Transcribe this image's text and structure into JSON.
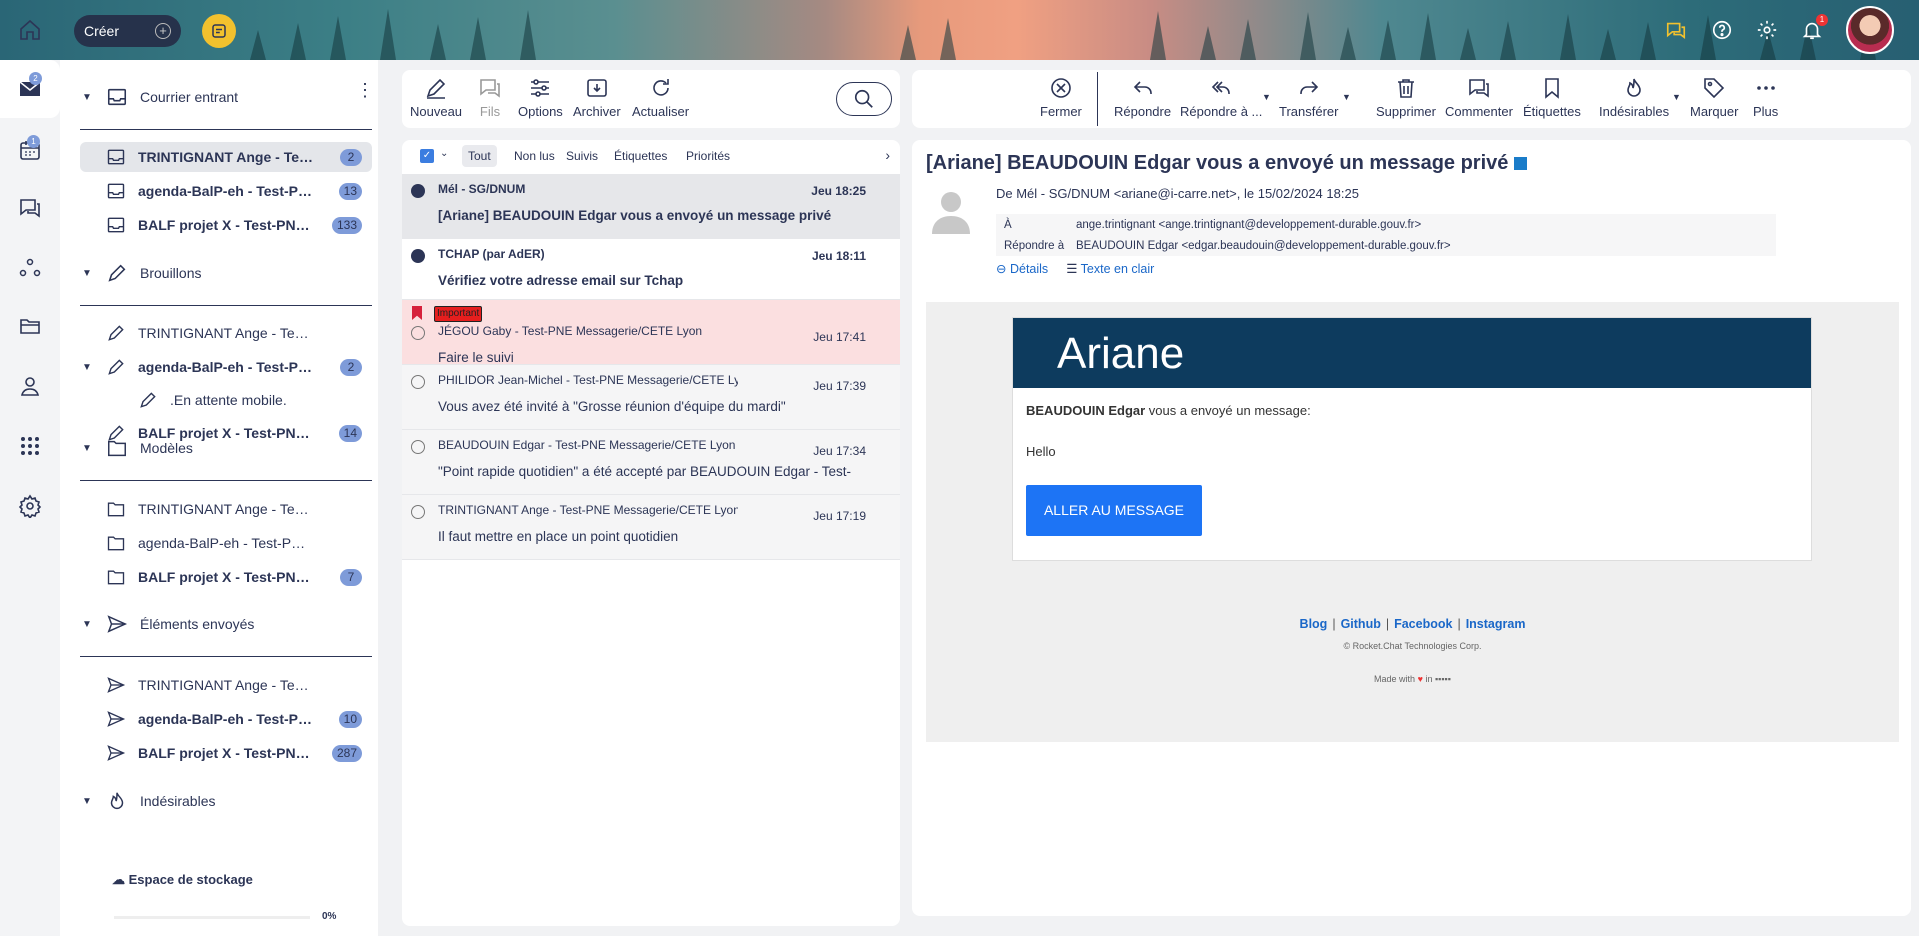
{
  "topbar": {
    "create_label": "Créer",
    "create_plus": "+",
    "notifications_count": "1"
  },
  "leftnav": {
    "mail_badge": "2",
    "calendar_badge": "1"
  },
  "sidebar": {
    "groups": [
      {
        "label": "Courrier entrant",
        "icon": "inbox-icon",
        "items": [
          {
            "label": "TRINTIGNANT Ange - Test-PNE Messagerie/CETE Lyon",
            "badge": "2",
            "bold": true
          },
          {
            "label": "agenda-BalP-eh - Test-PNE Messagerie/CETE Lyon",
            "badge": "13",
            "bold": true
          },
          {
            "label": "BALF projet X - Test-PNE Messagerie/CETE Lyon",
            "badge": "133",
            "bold": true
          }
        ]
      },
      {
        "label": "Brouillons",
        "icon": "pencil-icon",
        "items": [
          {
            "label": "TRINTIGNANT Ange - Test-PNE Messagerie/CETE Lyon",
            "badge": "",
            "bold": false
          },
          {
            "label": "agenda-BalP-eh - Test-PNE Messagerie/CETE Lyon",
            "badge": "2",
            "bold": true
          },
          {
            "label": ".En attente mobile.",
            "badge": "",
            "bold": false
          },
          {
            "label": "BALF projet X - Test-PNE Messagerie/CETE Lyon",
            "badge": "14",
            "bold": true
          }
        ]
      },
      {
        "label": "Modèles",
        "icon": "folder-icon",
        "items": [
          {
            "label": "TRINTIGNANT Ange - Test-PNE Messagerie/CETE Lyon",
            "badge": "",
            "bold": false
          },
          {
            "label": "agenda-BalP-eh - Test-PNE Messagerie/CETE Lyon",
            "badge": "",
            "bold": false
          },
          {
            "label": "BALF projet X - Test-PNE Messagerie/CETE Lyon",
            "badge": "7",
            "bold": true
          }
        ]
      },
      {
        "label": "Éléments envoyés",
        "icon": "send-icon",
        "items": [
          {
            "label": "TRINTIGNANT Ange - Test-PNE Messagerie/CETE Lyon",
            "badge": "",
            "bold": false
          },
          {
            "label": "agenda-BalP-eh - Test-PNE Messagerie/CETE Lyon",
            "badge": "10",
            "bold": true
          },
          {
            "label": "BALF projet X - Test-PNE Messagerie/CETE Lyon",
            "badge": "287",
            "bold": true
          }
        ]
      },
      {
        "label": "Indésirables",
        "icon": "flame-icon",
        "items": []
      }
    ],
    "storage_label": "Espace de stockage",
    "storage_percent": "0%"
  },
  "list_toolbar": {
    "new": "Nouveau",
    "threads": "Fils",
    "options": "Options",
    "archive": "Archiver",
    "refresh": "Actualiser"
  },
  "filters": [
    "Tout",
    "Non lus",
    "Suivis",
    "Étiquettes",
    "Priorités"
  ],
  "messages": [
    {
      "from": "Mél - SG/DNUM",
      "date": "Jeu 18:25",
      "subject": "[Ariane] BEAUDOUIN Edgar vous a envoyé un message privé",
      "unread": true,
      "selected": true,
      "tag": ""
    },
    {
      "from": "TCHAP (par AdER)",
      "date": "Jeu 18:11",
      "subject": "Vérifiez votre adresse email sur Tchap",
      "unread": true,
      "selected": false,
      "tag": ""
    },
    {
      "from": "JÉGOU Gaby - Test-PNE Messagerie/CETE Lyon",
      "date": "Jeu 17:41",
      "subject": "Faire le suivi",
      "unread": false,
      "selected": false,
      "tag": "Important"
    },
    {
      "from": "PHILIDOR Jean-Michel - Test-PNE Messagerie/CETE Lyon",
      "date": "Jeu 17:39",
      "subject": "Vous avez été invité à \"Grosse réunion d'équipe du mardi\"",
      "unread": false,
      "selected": false,
      "tag": ""
    },
    {
      "from": "BEAUDOUIN Edgar - Test-PNE Messagerie/CETE Lyon",
      "date": "Jeu 17:34",
      "subject": "\"Point rapide quotidien\" a été accepté par BEAUDOUIN Edgar - Test-",
      "unread": false,
      "selected": false,
      "tag": ""
    },
    {
      "from": "TRINTIGNANT Ange - Test-PNE Messagerie/CETE Lyon",
      "date": "Jeu 17:19",
      "subject": "Il faut mettre en place un point quotidien",
      "unread": false,
      "selected": false,
      "tag": ""
    }
  ],
  "reader_toolbar": {
    "close": "Fermer",
    "reply": "Répondre",
    "reply_all": "Répondre à ...",
    "forward": "Transférer",
    "delete": "Supprimer",
    "comment": "Commenter",
    "labels": "Étiquettes",
    "spam": "Indésirables",
    "mark": "Marquer",
    "more": "Plus"
  },
  "reader": {
    "title": "[Ariane] BEAUDOUIN Edgar vous a envoyé un message privé",
    "from_line": "De Mél - SG/DNUM <ariane@i-carre.net>, le 15/02/2024 18:25",
    "to_key": "À",
    "to_val": "ange.trintignant <ange.trintignant@developpement-durable.gouv.fr>",
    "replyto_key": "Répondre à",
    "replyto_val": "BEAUDOUIN Edgar <edgar.beaudouin@developpement-durable.gouv.fr>",
    "details": "Détails",
    "plaintext": "Texte en clair",
    "email": {
      "brand": "Ariane",
      "sender": "BEAUDOUIN Edgar",
      "sent_text": " vous a envoyé un message:",
      "body": "Hello",
      "button": "ALLER AU MESSAGE",
      "links": [
        "Blog",
        "Github",
        "Facebook",
        "Instagram"
      ],
      "copyright": "© Rocket.Chat Technologies Corp.",
      "made_with": "Made with",
      "made_in": "in"
    }
  },
  "colors": {
    "primary": "#2c3556",
    "badge": "#7e9bd9",
    "accent": "#1d74f5",
    "important": "#e61e1e"
  }
}
